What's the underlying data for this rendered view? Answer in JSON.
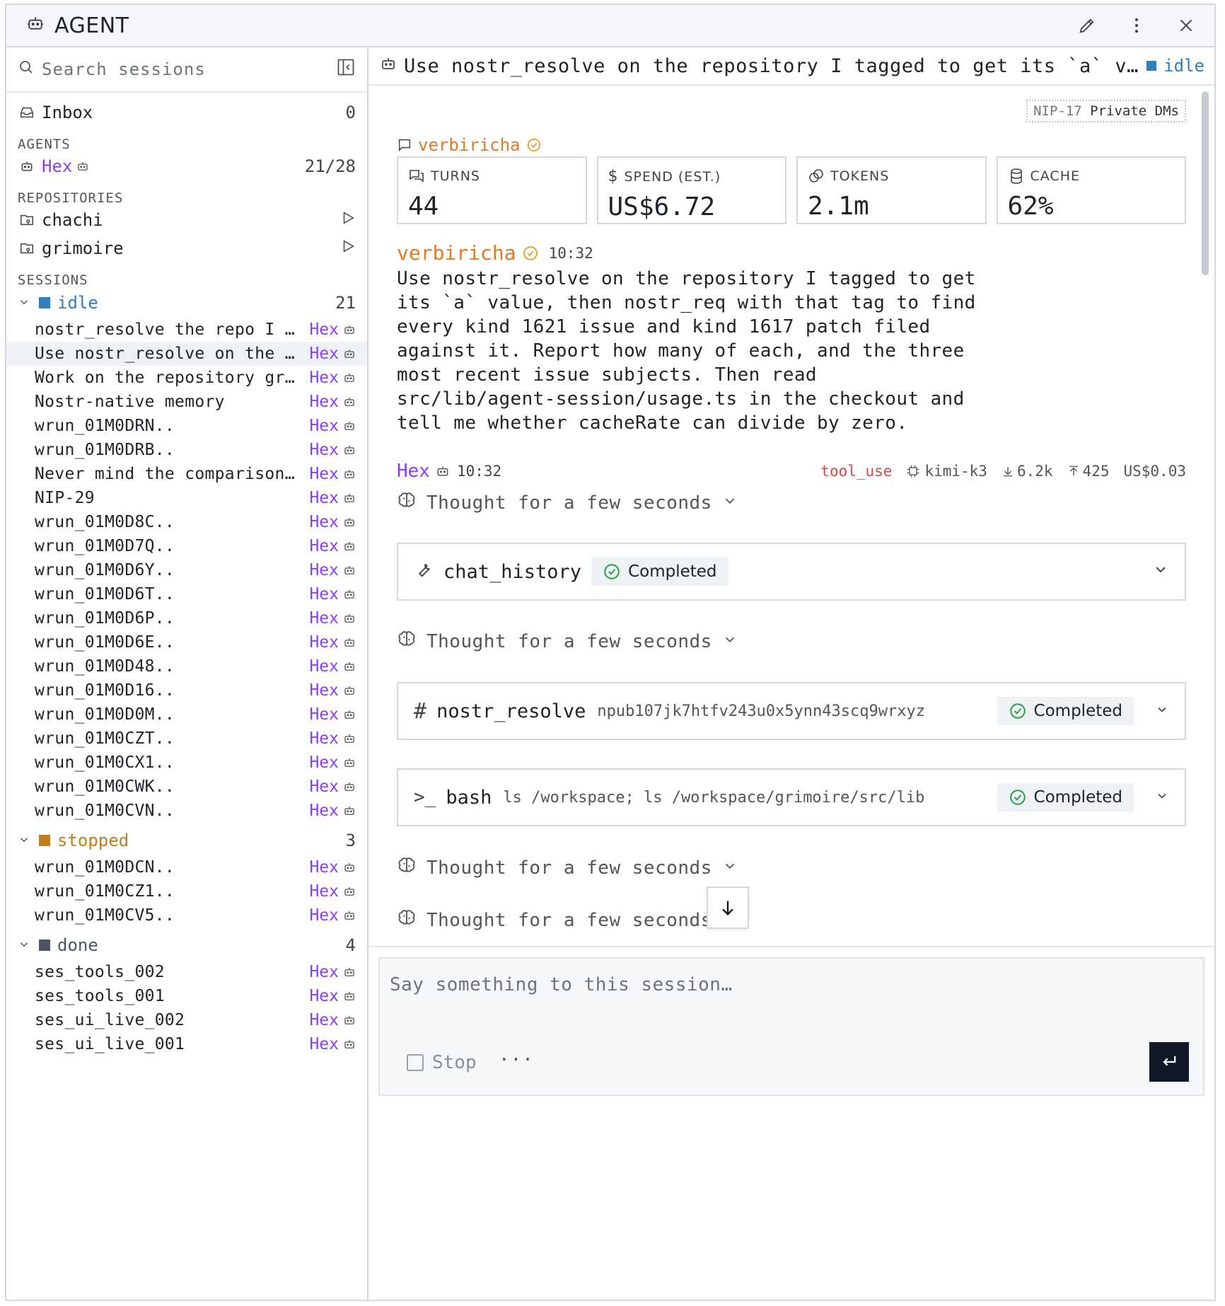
{
  "window": {
    "title": "AGENT"
  },
  "sidebar": {
    "search_placeholder": "Search sessions",
    "inbox": {
      "label": "Inbox",
      "count": "0"
    },
    "agents_heading": "AGENTS",
    "agents": [
      {
        "name": "Hex",
        "count": "21/28"
      }
    ],
    "repos_heading": "REPOSITORIES",
    "repos": [
      {
        "name": "chachi"
      },
      {
        "name": "grimoire"
      }
    ],
    "sessions_heading": "SESSIONS",
    "groups": [
      {
        "label": "idle",
        "count": "21",
        "color": "#2f7fbf",
        "items": [
          "nostr_resolve the repo I tagged, then nostr_req",
          "Use nostr_resolve on the repository I tagged",
          "Work on the repository grimoire",
          "Nostr-native memory",
          "wrun_01M0DRN..",
          "wrun_01M0DRB..",
          "Never mind the comparison, just",
          "NIP-29",
          "wrun_01M0D8C..",
          "wrun_01M0D7Q..",
          "wrun_01M0D6Y..",
          "wrun_01M0D6T..",
          "wrun_01M0D6P..",
          "wrun_01M0D6E..",
          "wrun_01M0D48..",
          "wrun_01M0D16..",
          "wrun_01M0D0M..",
          "wrun_01M0CZT..",
          "wrun_01M0CX1..",
          "wrun_01M0CWK..",
          "wrun_01M0CVN.."
        ]
      },
      {
        "label": "stopped",
        "count": "3",
        "color": "#c27c1a",
        "items": [
          "wrun_01M0DCN..",
          "wrun_01M0CZ1..",
          "wrun_01M0CV5.."
        ]
      },
      {
        "label": "done",
        "count": "4",
        "color": "#4b5563",
        "items": [
          "ses_tools_002",
          "ses_tools_001",
          "ses_ui_live_002",
          "ses_ui_live_001"
        ]
      }
    ],
    "session_agent": "Hex"
  },
  "main": {
    "title": "Use nostr_resolve on the repository I tagged to get its `a` value, then nostr_req with that tag",
    "status": "idle",
    "nip_tag_a": "NIP-17",
    "nip_tag_b": "Private DMs",
    "from_user": "verbiricha",
    "stats": [
      {
        "label": "TURNS",
        "value": "44"
      },
      {
        "label": "SPEND (EST.)",
        "value": "US$6.72"
      },
      {
        "label": "TOKENS",
        "value": "2.1m"
      },
      {
        "label": "CACHE",
        "value": "62%"
      }
    ],
    "user_message": {
      "author": "verbiricha",
      "time": "10:32",
      "text": "Use nostr_resolve on the repository I tagged to get its `a` value, then nostr_req with that tag to find every kind 1621 issue and kind 1617 patch filed against it. Report how many of each, and the three most recent issue subjects. Then read src/lib/agent-session/usage.ts in the checkout and tell me whether cacheRate can divide by zero."
    },
    "agent_message": {
      "author": "Hex",
      "time": "10:32",
      "stop_reason": "tool_use",
      "model": "kimi-k3",
      "tokens_in": "6.2k",
      "tokens_out": "425",
      "cost": "US$0.03"
    },
    "thought_label": "Thought for a few seconds",
    "tools": [
      {
        "name": "chat_history",
        "arg": "",
        "status": "Completed"
      },
      {
        "name": "nostr_resolve",
        "arg": "npub107jk7htfv243u0x5ynn43scq9wrxyz",
        "status": "Completed"
      },
      {
        "name": "bash",
        "arg": "ls /workspace; ls /workspace/grimoire/src/lib",
        "status": "Completed"
      }
    ]
  },
  "composer": {
    "placeholder": "Say something to this session…",
    "stop_label": "Stop",
    "more_label": "···"
  }
}
